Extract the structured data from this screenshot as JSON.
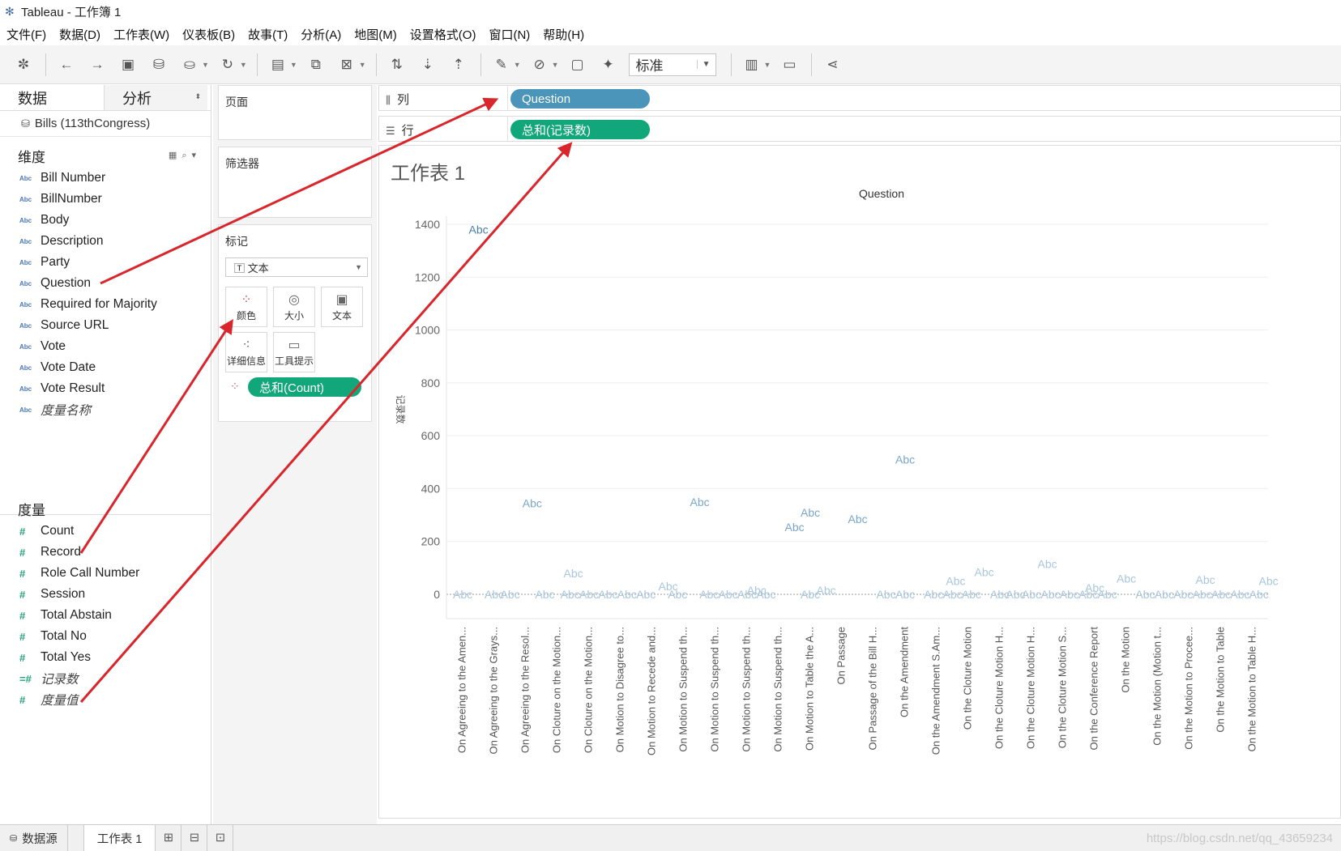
{
  "window": {
    "title": "Tableau - 工作簿 1"
  },
  "menu": [
    "文件(F)",
    "数据(D)",
    "工作表(W)",
    "仪表板(B)",
    "故事(T)",
    "分析(A)",
    "地图(M)",
    "设置格式(O)",
    "窗口(N)",
    "帮助(H)"
  ],
  "toolbar": {
    "fit_value": "标准"
  },
  "left_panel": {
    "tabs": [
      "数据",
      "分析"
    ],
    "datasource": "Bills (113thCongress)",
    "dimensions_title": "维度",
    "dimensions": [
      {
        "label": "Bill Number",
        "type": "Abc"
      },
      {
        "label": "BillNumber",
        "type": "Abc"
      },
      {
        "label": "Body",
        "type": "Abc"
      },
      {
        "label": "Description",
        "type": "Abc"
      },
      {
        "label": "Party",
        "type": "Abc"
      },
      {
        "label": "Question",
        "type": "Abc"
      },
      {
        "label": "Required for Majority",
        "type": "Abc"
      },
      {
        "label": "Source URL",
        "type": "Abc"
      },
      {
        "label": "Vote",
        "type": "Abc"
      },
      {
        "label": "Vote Date",
        "type": "Abc"
      },
      {
        "label": "Vote Result",
        "type": "Abc"
      },
      {
        "label": "度量名称",
        "type": "Abc",
        "italic": true
      }
    ],
    "measures_title": "度量",
    "measures": [
      {
        "label": "Count",
        "type": "#"
      },
      {
        "label": "Record",
        "type": "#"
      },
      {
        "label": "Role Call Number",
        "type": "#"
      },
      {
        "label": "Session",
        "type": "#"
      },
      {
        "label": "Total Abstain",
        "type": "#"
      },
      {
        "label": "Total No",
        "type": "#"
      },
      {
        "label": "Total Yes",
        "type": "#"
      },
      {
        "label": "记录数",
        "type": "=#",
        "italic": true
      },
      {
        "label": "度量值",
        "type": "#",
        "italic": true
      }
    ]
  },
  "shelves": {
    "pages_title": "页面",
    "filters_title": "筛选器",
    "marks_title": "标记",
    "mark_type": "文本",
    "mark_buttons": [
      "颜色",
      "大小",
      "文本",
      "详细信息",
      "工具提示"
    ],
    "marks_pill": "总和(Count)",
    "columns_label": "列",
    "rows_label": "行",
    "columns_pill": "Question",
    "rows_pill": "总和(记录数)"
  },
  "sheet": {
    "title": "工作表 1"
  },
  "chart_data": {
    "type": "scatter",
    "title": "Question",
    "ylabel": "记录数",
    "ylim": [
      0,
      1400
    ],
    "yticks": [
      0,
      200,
      400,
      600,
      800,
      1000,
      1200,
      1400
    ],
    "mark_label": "Abc",
    "grid": true,
    "categories": [
      "On Agreeing to the Amen...",
      "On Agreeing to the Grays...",
      "On Agreeing to the Resol...",
      "On Cloture on the Motion...",
      "On Cloture on the Motion...",
      "On Motion to Disagree to...",
      "On Motion to Recede and...",
      "On Motion to Suspend th...",
      "On Motion to Suspend th...",
      "On Motion to Suspend th...",
      "On Motion to Suspend th...",
      "On Motion to Table the A...",
      "On Passage",
      "On Passage of the Bill H...",
      "On the Amendment",
      "On the Amendment S.Am...",
      "On the Cloture Motion",
      "On the Cloture Motion H...",
      "On the Cloture Motion H...",
      "On the Cloture Motion S...",
      "On the Conference Report",
      "On the Motion",
      "On the Motion (Motion t...",
      "On the Motion to Procee...",
      "On the Motion to Table",
      "On the Motion to Table H..."
    ],
    "points": [
      {
        "x": 0.5,
        "y": 1380
      },
      {
        "x": 2.2,
        "y": 345
      },
      {
        "x": 3.5,
        "y": 80
      },
      {
        "x": 7.5,
        "y": 350
      },
      {
        "x": 10.5,
        "y": 255
      },
      {
        "x": 11.0,
        "y": 310
      },
      {
        "x": 12.5,
        "y": 285
      },
      {
        "x": 14.0,
        "y": 510
      },
      {
        "x": 15.6,
        "y": 50
      },
      {
        "x": 16.5,
        "y": 85
      },
      {
        "x": 18.5,
        "y": 115
      },
      {
        "x": 21.0,
        "y": 60
      },
      {
        "x": 23.5,
        "y": 55
      },
      {
        "x": 25.5,
        "y": 50
      },
      {
        "x": 9.3,
        "y": 15
      },
      {
        "x": 11.5,
        "y": 15
      },
      {
        "x": 6.5,
        "y": 30
      },
      {
        "x": 20.0,
        "y": 25
      },
      {
        "x": 0.0,
        "y": 0
      },
      {
        "x": 1.0,
        "y": 0
      },
      {
        "x": 1.5,
        "y": 0
      },
      {
        "x": 2.6,
        "y": 0
      },
      {
        "x": 3.4,
        "y": 0
      },
      {
        "x": 4.0,
        "y": 0
      },
      {
        "x": 4.6,
        "y": 0
      },
      {
        "x": 5.2,
        "y": 0
      },
      {
        "x": 5.8,
        "y": 0
      },
      {
        "x": 6.8,
        "y": 0
      },
      {
        "x": 7.8,
        "y": 0
      },
      {
        "x": 8.4,
        "y": 0
      },
      {
        "x": 9.0,
        "y": 0
      },
      {
        "x": 9.6,
        "y": 0
      },
      {
        "x": 11.0,
        "y": 0
      },
      {
        "x": 13.4,
        "y": 0
      },
      {
        "x": 14.0,
        "y": 0
      },
      {
        "x": 14.9,
        "y": 0
      },
      {
        "x": 15.5,
        "y": 0
      },
      {
        "x": 16.1,
        "y": 0
      },
      {
        "x": 17.0,
        "y": 0
      },
      {
        "x": 17.5,
        "y": 0
      },
      {
        "x": 18.0,
        "y": 0
      },
      {
        "x": 18.6,
        "y": 0
      },
      {
        "x": 19.2,
        "y": 0
      },
      {
        "x": 19.8,
        "y": 0
      },
      {
        "x": 20.4,
        "y": 0
      },
      {
        "x": 21.6,
        "y": 0
      },
      {
        "x": 22.2,
        "y": 0
      },
      {
        "x": 22.8,
        "y": 0
      },
      {
        "x": 23.4,
        "y": 0
      },
      {
        "x": 24.0,
        "y": 0
      },
      {
        "x": 24.6,
        "y": 0
      },
      {
        "x": 25.2,
        "y": 0
      }
    ]
  },
  "bottom_tabs": {
    "datasource": "数据源",
    "sheet": "工作表 1"
  },
  "watermark": "https://blog.csdn.net/qq_43659234"
}
